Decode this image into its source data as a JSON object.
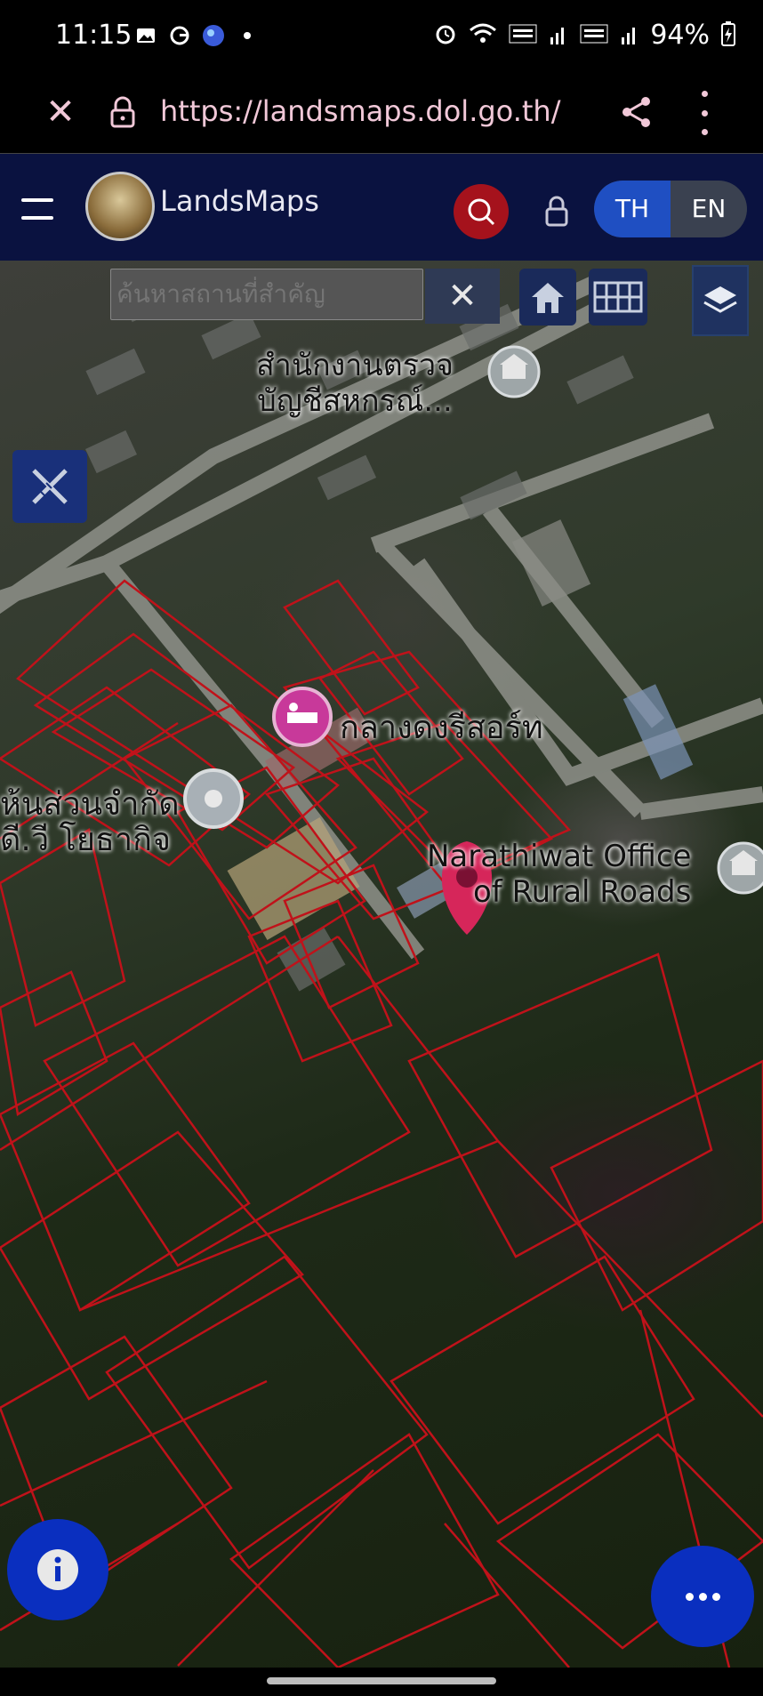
{
  "status_bar": {
    "time": "11:15",
    "battery": "94%",
    "left_icons": [
      "image-icon",
      "google-icon",
      "app-icon",
      "dot-icon"
    ],
    "right_icons": [
      "alarm-icon",
      "wifi-icon",
      "volte-lte1-icon",
      "signal-icon",
      "volte-lte2-icon",
      "signal-icon",
      "battery-charging-icon"
    ]
  },
  "browser": {
    "url": "https://landsmaps.dol.go.th/"
  },
  "header": {
    "brand": "LandsMaps",
    "lang_th": "TH",
    "lang_en": "EN",
    "active_lang": "TH"
  },
  "search": {
    "placeholder": "ค้นหาสถานที่สำคัญ",
    "clear_label": "✕"
  },
  "map": {
    "labels": {
      "office_audit": "สำนักงานตรวจ\nบัญชีสหกรณ์...",
      "resort": "กลางดงรีสอร์ท",
      "company": "ห้นส่วนจำกัด\nดี.วี โยธากิจ",
      "rural_roads_1": "Narathiwat Office",
      "rural_roads_2": "of Rural Roads"
    }
  },
  "colors": {
    "header_bg": "#0a1240",
    "accent_blue": "#1f4fc2",
    "search_red": "#a5121c",
    "parcel_line": "#c0121a",
    "fab_blue": "#0a2fbf",
    "pin_red": "#d6265a"
  }
}
